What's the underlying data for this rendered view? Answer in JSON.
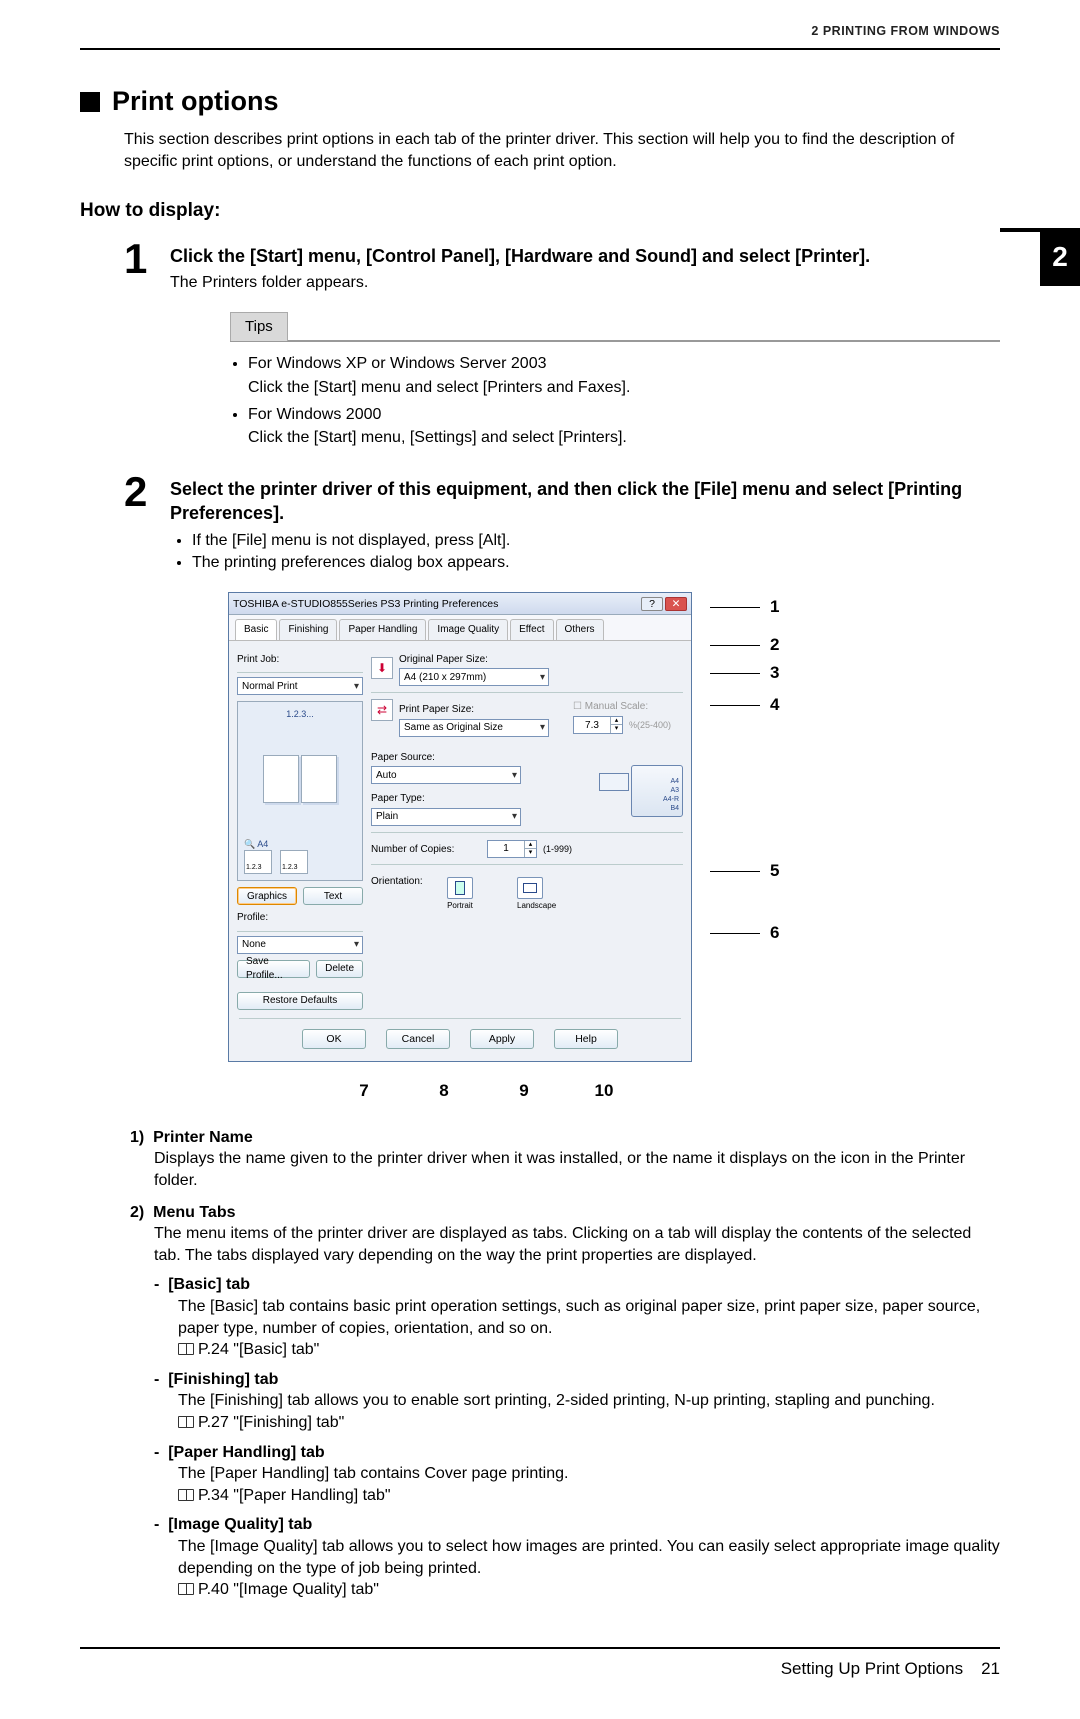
{
  "running_head": "2 PRINTING FROM WINDOWS",
  "chapter_tab": "2",
  "h1": "Print options",
  "intro": "This section describes print options in each tab of the printer driver. This section will help you to find the description of specific print options, or understand the functions of each print option.",
  "h2": "How to display:",
  "step1": {
    "num": "1",
    "title": "Click the [Start] menu, [Control Panel], [Hardware and Sound] and select [Printer].",
    "body": "The Printers folder appears."
  },
  "tips_label": "Tips",
  "tips": {
    "xp_line1": "For Windows XP or Windows Server 2003",
    "xp_line2": "Click the [Start] menu and select [Printers and Faxes].",
    "w2k_line1": "For Windows 2000",
    "w2k_line2": "Click the [Start] menu, [Settings] and select [Printers]."
  },
  "step2": {
    "num": "2",
    "title": "Select the printer driver of this equipment, and then click the [File] menu and select [Printing Preferences].",
    "b1": "If the [File] menu is not displayed, press [Alt].",
    "b2": "The printing preferences dialog box appears."
  },
  "dialog": {
    "title": "TOSHIBA e-STUDIO855Series PS3 Printing Preferences",
    "tabs": [
      "Basic",
      "Finishing",
      "Paper Handling",
      "Image Quality",
      "Effect",
      "Others"
    ],
    "print_job_label": "Print Job:",
    "print_job_value": "Normal Print",
    "preview_top": "1.2.3...",
    "preview_sizelabel": "A4",
    "preview_mini_left": "1.2.3",
    "preview_mini_right": "1.2.3",
    "graphics_btn": "Graphics",
    "text_btn": "Text",
    "profile_label": "Profile:",
    "profile_value": "None",
    "save_profile_btn": "Save Profile...",
    "delete_btn": "Delete",
    "restore_btn": "Restore Defaults",
    "orig_size_label": "Original Paper Size:",
    "orig_size_value": "A4 (210 x 297mm)",
    "print_size_label": "Print Paper Size:",
    "print_size_value": "Same as Original Size",
    "manual_scale_label": "Manual Scale:",
    "manual_scale_value": "7.3",
    "manual_scale_range": "%(25-400)",
    "paper_source_label": "Paper Source:",
    "paper_source_value": "Auto",
    "paper_type_label": "Paper Type:",
    "paper_type_value": "Plain",
    "tray_sizes": [
      "A4",
      "A3",
      "A4-R",
      "B4"
    ],
    "copies_label": "Number of Copies:",
    "copies_value": "1",
    "copies_range": "(1-999)",
    "orientation_label": "Orientation:",
    "orient_portrait_sub": "Portrait",
    "orient_landscape_sub": "Landscape",
    "ok": "OK",
    "cancel": "Cancel",
    "apply": "Apply",
    "help": "Help"
  },
  "callouts": {
    "c1": "1",
    "c2": "2",
    "c3": "3",
    "c4": "4",
    "c5": "5",
    "c6": "6",
    "c7": "7",
    "c8": "8",
    "c9": "9",
    "c10": "10"
  },
  "desc": {
    "d1": {
      "head": "1)  Printer Name",
      "body": "Displays the name given to the printer driver when it was installed, or the name it displays on the icon in the Printer folder."
    },
    "d2": {
      "head": "2)  Menu Tabs",
      "body": "The menu items of the printer driver are displayed as tabs. Clicking on a tab will display the contents of the selected tab. The tabs displayed vary depending on the way the print properties are displayed.",
      "basic_head": "-  [Basic] tab",
      "basic_body": "The [Basic] tab contains basic print operation settings, such as original paper size, print paper size, paper source, paper type, number of copies, orientation, and so on.",
      "basic_ref": "P.24 \"[Basic] tab\"",
      "finishing_head": "-  [Finishing] tab",
      "finishing_body": "The [Finishing] tab allows you to enable sort printing, 2-sided printing, N-up printing, stapling and punching.",
      "finishing_ref": "P.27 \"[Finishing] tab\"",
      "ph_head": "-  [Paper Handling] tab",
      "ph_body": "The [Paper Handling] tab contains Cover page printing.",
      "ph_ref": "P.34 \"[Paper Handling] tab\"",
      "iq_head": "-  [Image Quality] tab",
      "iq_body": "The [Image Quality] tab allows you to select how images are printed. You can easily select appropriate image quality depending on the type of job being printed.",
      "iq_ref": "P.40 \"[Image Quality] tab\""
    }
  },
  "footer": {
    "section": "Setting Up Print Options",
    "page": "21"
  }
}
